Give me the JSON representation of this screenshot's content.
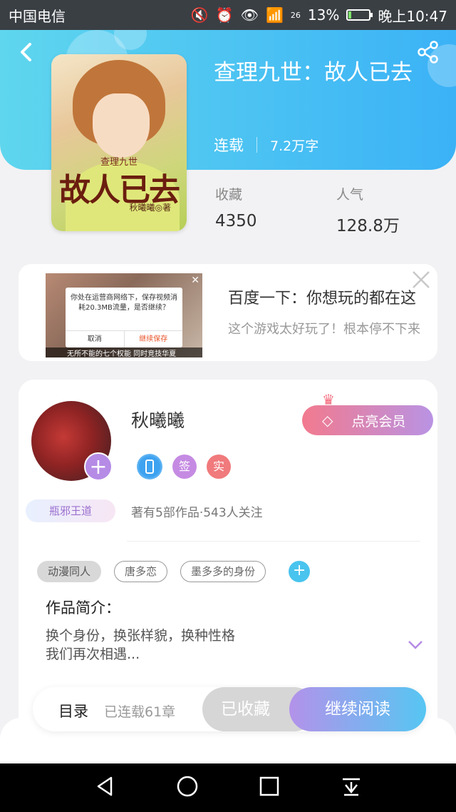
{
  "status_bar": {
    "carrier": "中国电信",
    "signal": "26",
    "battery": "13%",
    "time": "晚上10:47"
  },
  "book": {
    "title": "查理九世：故人已去",
    "status": "连载",
    "word_count": "7.2万字",
    "cover": {
      "series": "查理九世",
      "title": "故人已去",
      "author": "秋曦曦◎著"
    }
  },
  "stats": [
    {
      "label": "收藏",
      "value": "4350"
    },
    {
      "label": "人气",
      "value": "128.8万"
    }
  ],
  "ad": {
    "title": "百度一下：你想玩的都在这",
    "description": "这个游戏太好玩了！根本停不下来",
    "dialog_message": "你处在运营商网络下，保存视频消耗20.3MB流量，是否继续？",
    "dialog_cancel": "取消",
    "dialog_ok": "继续保存",
    "strip_text": "无所不能的七个权能 同时竞技华夏"
  },
  "author": {
    "name": "秋曦曦",
    "vip_button": "点亮会员",
    "badges": [
      {
        "icon": "phone-icon",
        "text": ""
      },
      {
        "text": "签"
      },
      {
        "text": "实"
      }
    ],
    "rank_badge": "瓶邪王道",
    "stats": "著有5部作品·543人关注"
  },
  "tags": [
    "动漫同人",
    "唐多恋",
    "墨多多的身份"
  ],
  "intro": {
    "label": "作品简介：",
    "line1": "换个身份，换张样貌，换种性格",
    "line2": "我们再次相遇..."
  },
  "bottom_bar": {
    "toc": "目录",
    "chapters": "已连载61章",
    "collected": "已收藏",
    "read": "继续阅读"
  },
  "colors": {
    "hero_start": "#5fd6ee",
    "hero_end": "#3bb2f6",
    "accent_purple": "#b58be6",
    "vip_pink": "#f27a8e"
  }
}
